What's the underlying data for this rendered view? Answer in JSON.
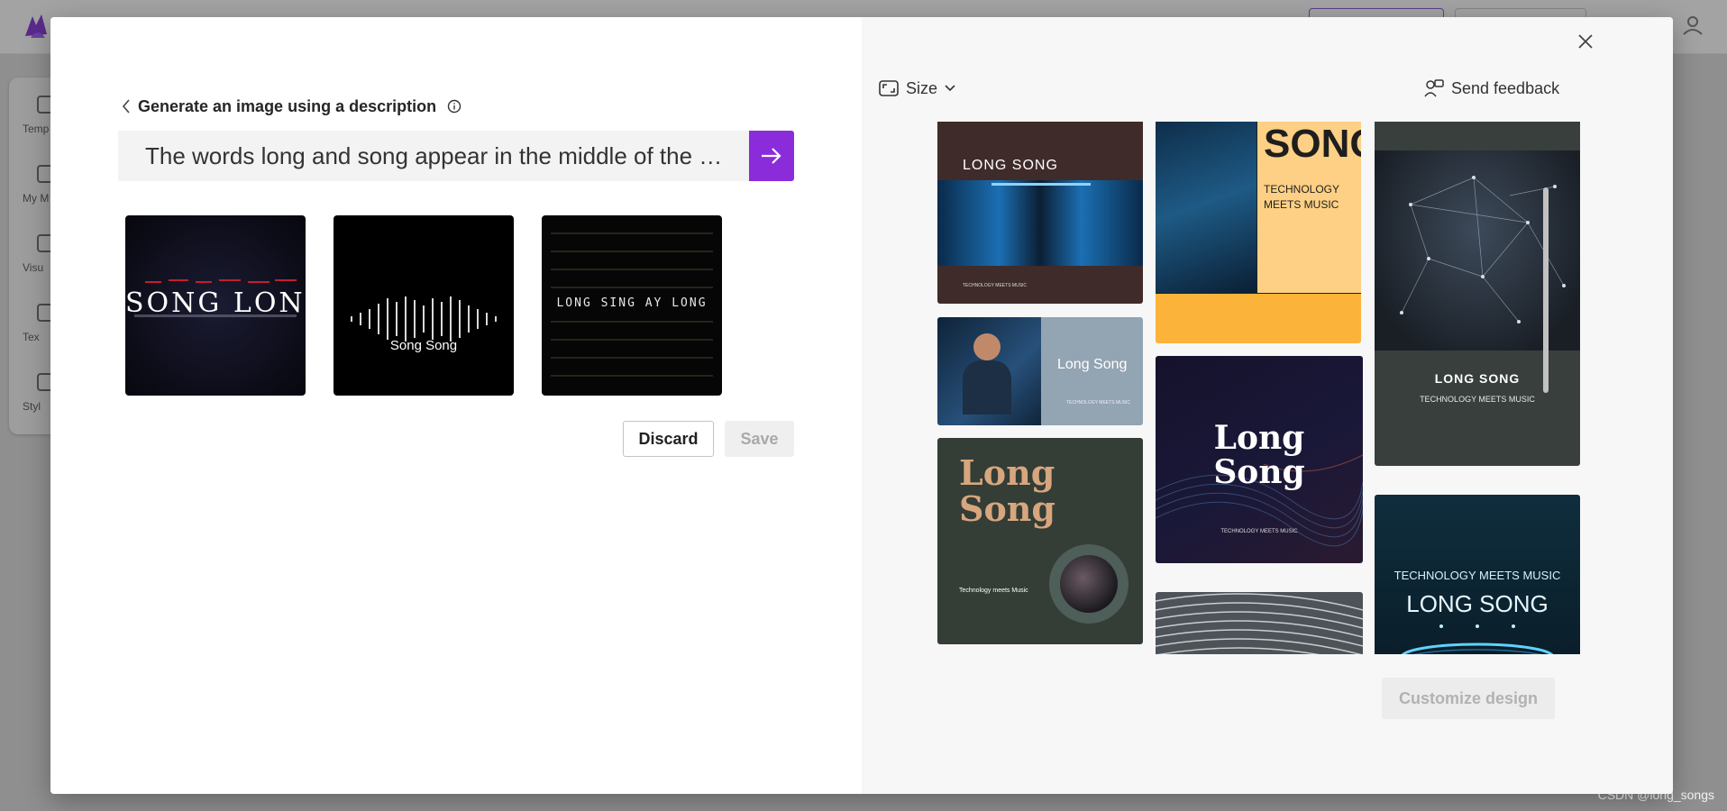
{
  "dialog": {
    "back_title": "Generate an image using a description",
    "prompt_value": "The words long and song appear in the middle of the sc...",
    "results": [
      {
        "text": "SONG LONG"
      },
      {
        "text": "Song Song"
      },
      {
        "text": "LONG SING AY LONG"
      }
    ],
    "discard_label": "Discard",
    "save_label": "Save",
    "size_label": "Size",
    "feedback_label": "Send feedback",
    "customize_label": "Customize design"
  },
  "templates": {
    "t1": {
      "title": "LONG SONG",
      "sub": "TECHNOLOGY MEETS MUSIC"
    },
    "t2": {
      "title": "Long Song",
      "sub": "TECHNOLOGY MEETS MUSIC"
    },
    "t3": {
      "title1": "Long",
      "title2": "Song",
      "sub": "Technology meets Music"
    },
    "t4": {
      "title": "SONG",
      "sub1": "TECHNOLOGY",
      "sub2": "MEETS MUSIC"
    },
    "t5": {
      "title1": "Long",
      "title2": "Song",
      "sub": "TECHNOLOGY MEETS MUSIC"
    },
    "t7": {
      "title": "LONG SONG",
      "sub": "TECHNOLOGY MEETS MUSIC"
    },
    "t8": {
      "title": "LONG SONG",
      "sub": "TECHNOLOGY MEETS MUSIC"
    }
  },
  "background": {
    "rail_labels": [
      "Temp",
      "My M",
      "Visu",
      "Tex",
      "Styl"
    ]
  },
  "watermark": "CSDN @long_songs",
  "colors": {
    "accent": "#8b2cdb",
    "overlay": "#8f8f8f",
    "right_pane": "#f7f7f7"
  },
  "icons": {
    "back": "chevron-left-icon",
    "info": "info-icon",
    "submit": "arrow-right-icon",
    "close": "close-icon",
    "size": "aspect-ratio-icon",
    "size_dropdown": "chevron-down-icon",
    "feedback": "feedback-icon"
  }
}
